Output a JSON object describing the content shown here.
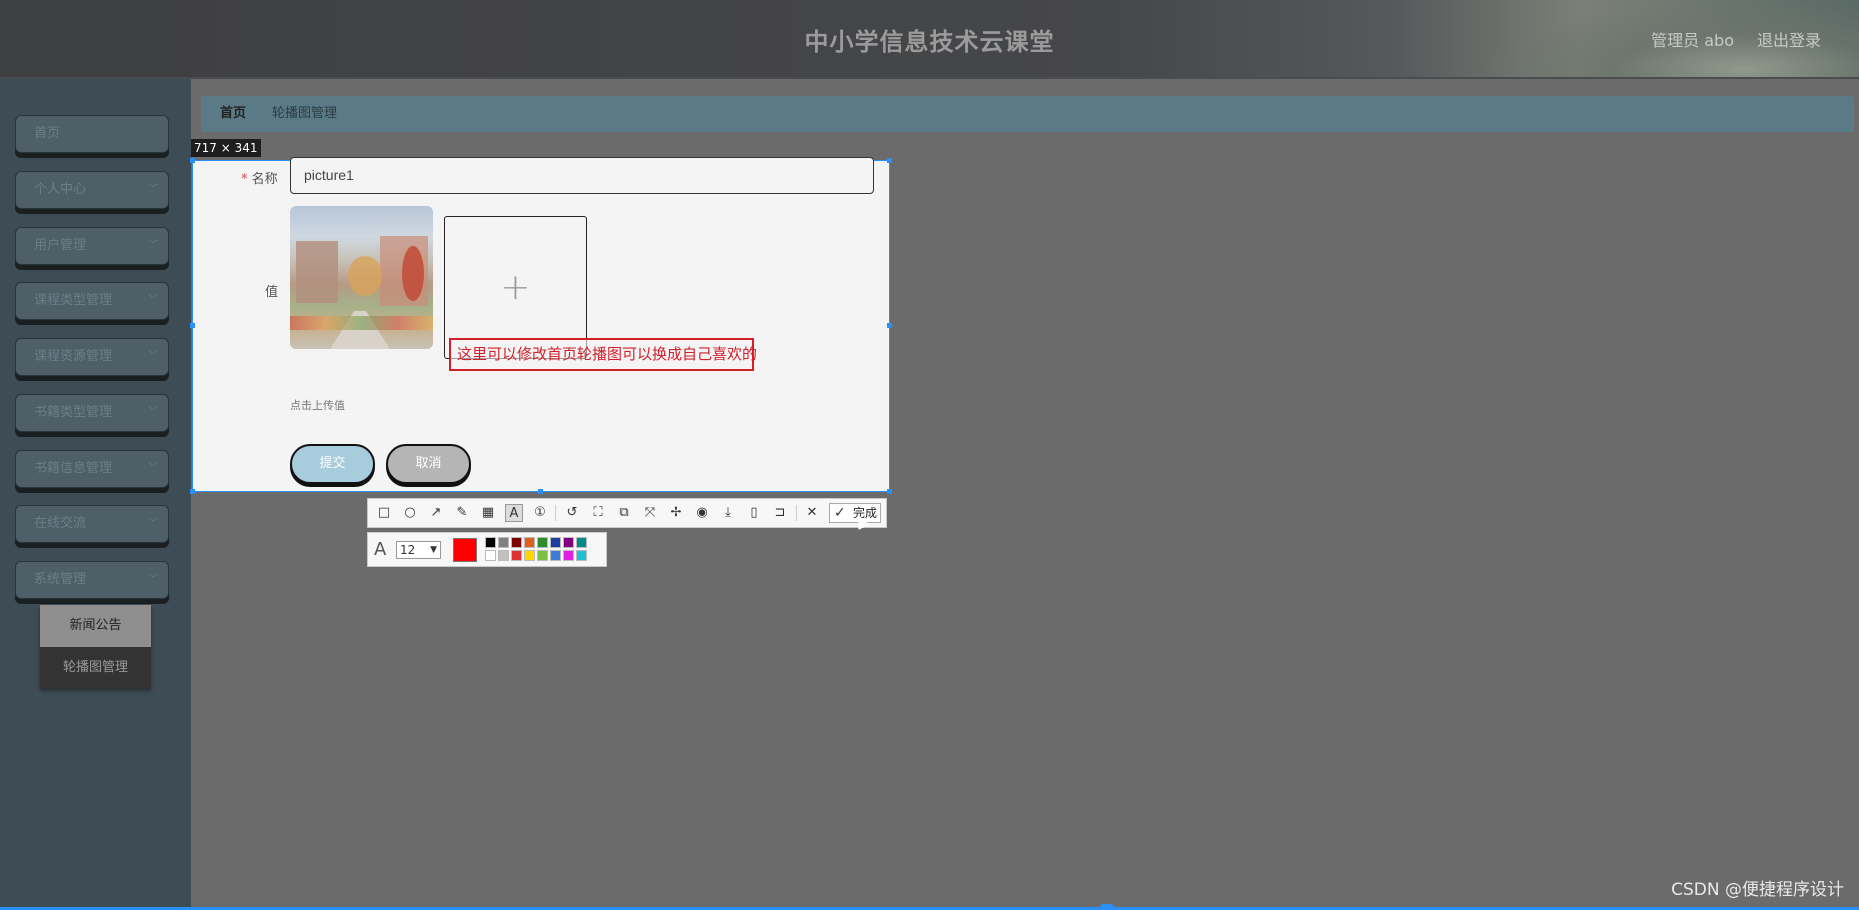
{
  "header": {
    "title": "中小学信息技术云课堂",
    "admin": "管理员 abo",
    "logout": "退出登录"
  },
  "sidebar": {
    "items": [
      {
        "label": "首页",
        "has_chevron": false
      },
      {
        "label": "个人中心",
        "has_chevron": true
      },
      {
        "label": "用户管理",
        "has_chevron": true
      },
      {
        "label": "课程类型管理",
        "has_chevron": true
      },
      {
        "label": "课程资源管理",
        "has_chevron": true
      },
      {
        "label": "书籍类型管理",
        "has_chevron": true
      },
      {
        "label": "书籍信息管理",
        "has_chevron": true
      },
      {
        "label": "在线交流",
        "has_chevron": true
      },
      {
        "label": "系统管理",
        "has_chevron": true
      }
    ],
    "submenu": [
      {
        "label": "新闻公告"
      },
      {
        "label": "轮播图管理"
      }
    ]
  },
  "breadcrumb": {
    "home": "首页",
    "current": "轮播图管理"
  },
  "capture": {
    "size_label": "717 × 341"
  },
  "form": {
    "name_label": "名称",
    "required_mark": "*",
    "name_value": "picture1",
    "value_label": "值",
    "upload_hint": "点击上传值",
    "annotation_text": "这里可以修改首页轮播图可以换成自己喜欢的",
    "submit": "提交",
    "cancel": "取消"
  },
  "toolbar": {
    "tools": [
      "rectangle-icon",
      "ellipse-icon",
      "arrow-icon",
      "pencil-icon",
      "mosaic-icon",
      "text-icon",
      "number-icon",
      "undo-icon",
      "ocr-icon",
      "translate-icon",
      "long-screenshot-icon",
      "pin-icon",
      "record-icon",
      "download-icon",
      "copy-device-icon",
      "bookmark-icon",
      "close-icon"
    ],
    "done": "完成",
    "font_size": "12"
  },
  "palette": {
    "current": "#ff0000",
    "row1": [
      "#000000",
      "#808080",
      "#800000",
      "#e06020",
      "#2e8b2e",
      "#1f3ea0",
      "#800080",
      "#008b8b"
    ],
    "row2": [
      "#ffffff",
      "#c0c0c0",
      "#e03030",
      "#ffd700",
      "#7bc043",
      "#3a7bd5",
      "#e020e0",
      "#20c0d0"
    ]
  },
  "watermark": "CSDN @便捷程序设计"
}
